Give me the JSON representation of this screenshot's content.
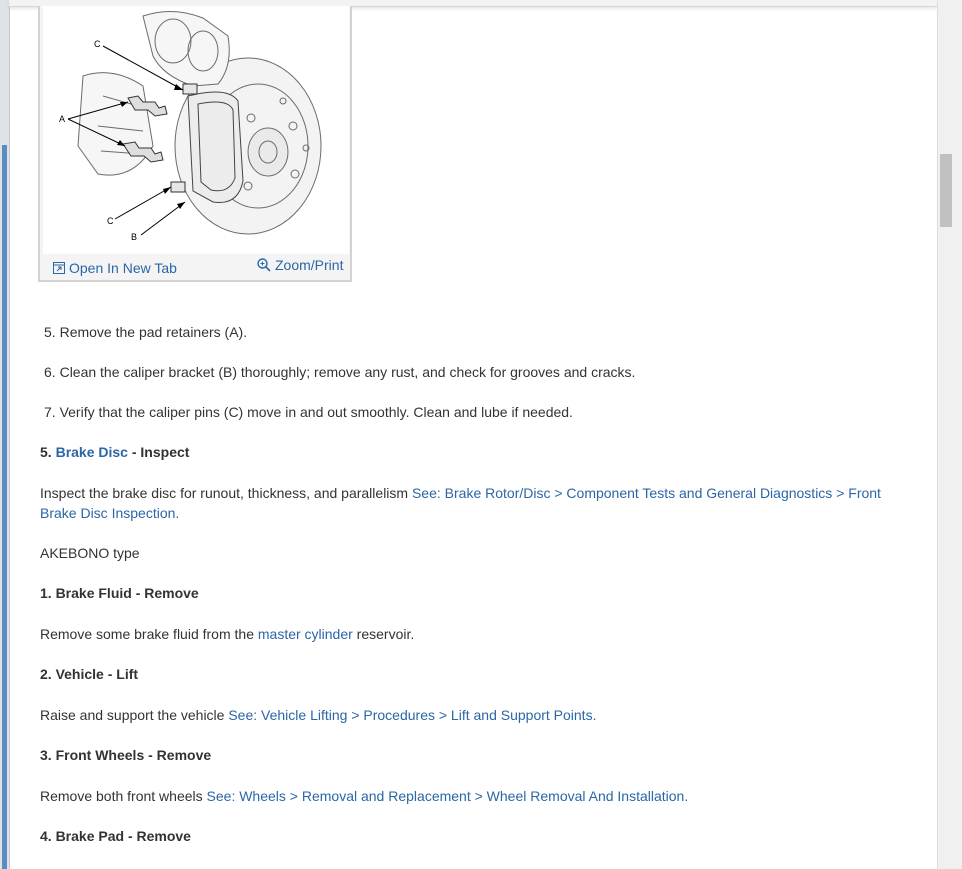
{
  "figure": {
    "open_tab_label": "Open In New Tab",
    "zoom_label": "Zoom/Print",
    "callouts": {
      "c_top": "C",
      "a": "A",
      "c_bottom": "C",
      "b": "B"
    }
  },
  "steps": [
    {
      "num": "5.",
      "text": "Remove the pad retainers (A)."
    },
    {
      "num": "6.",
      "text": "Clean the caliper bracket (B) thoroughly; remove any rust, and check for grooves and cracks."
    },
    {
      "num": "7.",
      "text": "Verify that the caliper pins (C) move in and out smoothly. Clean and lube if needed."
    }
  ],
  "sections": {
    "brake_disc": {
      "num": "5.",
      "link": "Brake Disc",
      "suffix": " - Inspect",
      "text": "Inspect the brake disc for runout, thickness, and parallelism ",
      "see_link_line1": "See: Brake Rotor/Disc > Component Tests and General Diagnostics > Front",
      "see_link_line2": "Brake Disc Inspection",
      "end": "."
    },
    "akebono": "AKEBONO type",
    "brake_fluid": {
      "heading": "1. Brake Fluid - Remove",
      "pre": "Remove some brake fluid from the ",
      "link": "master cylinder",
      "post": " reservoir."
    },
    "vehicle": {
      "heading": "2. Vehicle - Lift",
      "pre": "Raise and support the vehicle ",
      "link": "See: Vehicle Lifting > Procedures > Lift and Support Points",
      "end": "."
    },
    "wheels": {
      "heading": "3. Front Wheels - Remove",
      "pre": "Remove both front wheels ",
      "link": "See: Wheels > Removal and Replacement > Wheel Removal And Installation",
      "end": "."
    },
    "brake_pad": {
      "heading": "4. Brake Pad - Remove"
    }
  }
}
